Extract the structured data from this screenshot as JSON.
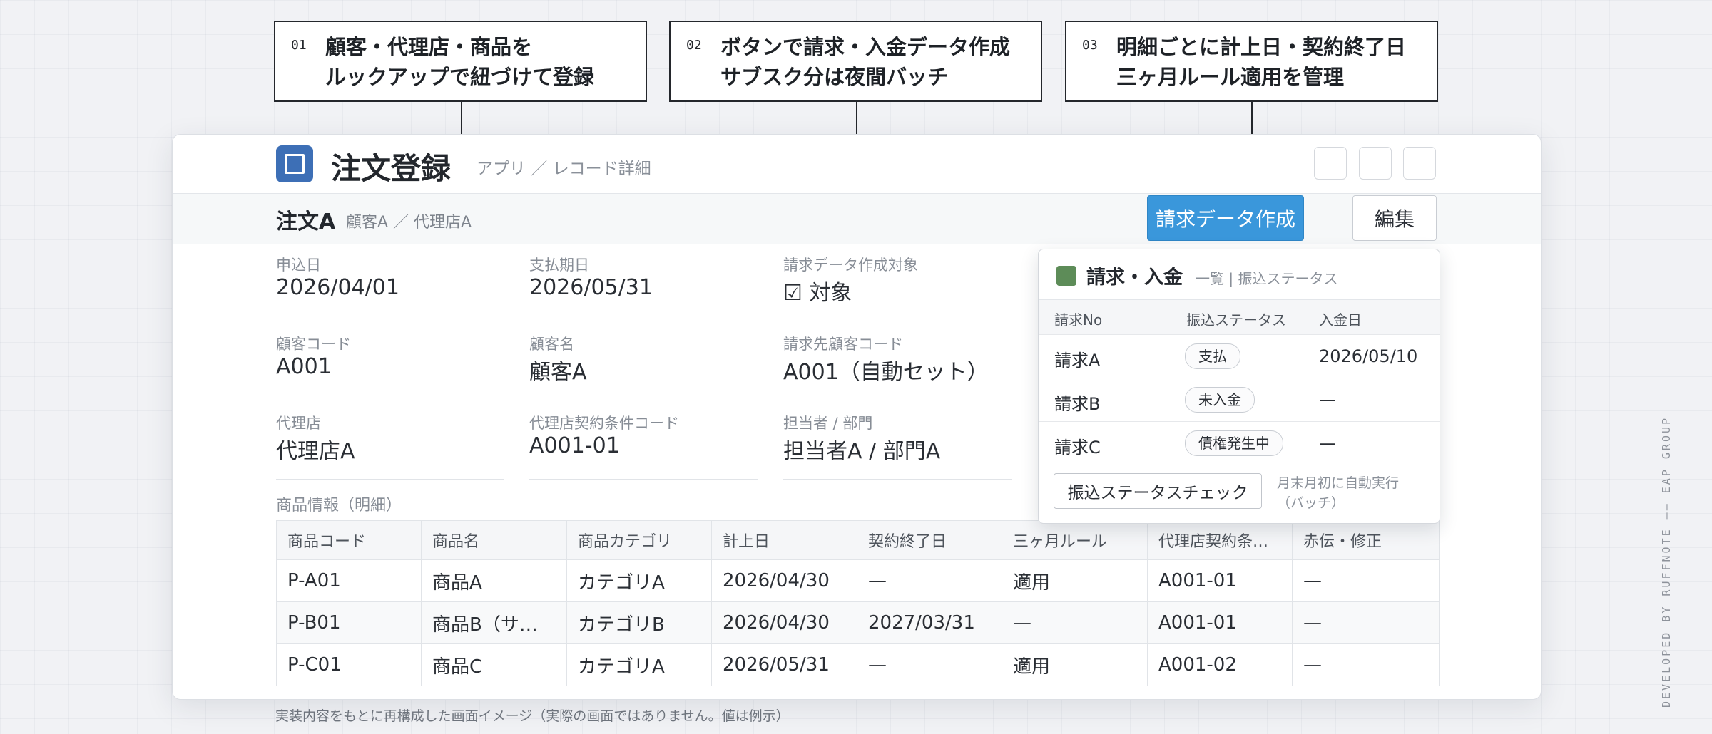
{
  "callouts": [
    {
      "num": "01",
      "line1": "顧客・代理店・商品を",
      "line2": "ルックアップで紐づけて登録"
    },
    {
      "num": "02",
      "line1": "ボタンで請求・入金データ作成",
      "line2": "サブスク分は夜間バッチ"
    },
    {
      "num": "03",
      "line1": "明細ごとに計上日・契約終了日",
      "line2": "三ヶ月ルール適用を管理"
    }
  ],
  "app": {
    "title": "注文登録",
    "breadcrumb": "アプリ ／ レコード詳細",
    "icon": "app-icon",
    "accent": "#3d6fb6"
  },
  "record": {
    "name": "注文A",
    "sub": "顧客A ／ 代理店A",
    "create_button": "請求データ作成",
    "edit_button": "編集",
    "primary_color": "#3a97db"
  },
  "fields": [
    {
      "label": "申込日",
      "value": "2026/04/01"
    },
    {
      "label": "支払期日",
      "value": "2026/05/31"
    },
    {
      "label": "請求データ作成対象",
      "value": "☑ 対象"
    },
    {
      "label": "顧客コード",
      "value": "A001"
    },
    {
      "label": "顧客名",
      "value": "顧客A"
    },
    {
      "label": "請求先顧客コード",
      "value": "A001（自動セット）"
    },
    {
      "label": "代理店",
      "value": "代理店A"
    },
    {
      "label": "代理店契約条件コード",
      "value": "A001-01"
    },
    {
      "label": "担当者 / 部門",
      "value": "担当者A / 部門A"
    }
  ],
  "detail": {
    "section_label": "商品情報（明細）",
    "columns": [
      "商品コード",
      "商品名",
      "商品カテゴリ",
      "計上日",
      "契約終了日",
      "三ヶ月ルール",
      "代理店契約条…",
      "赤伝・修正"
    ],
    "rows": [
      [
        "P-A01",
        "商品A",
        "カテゴリA",
        "2026/04/30",
        "—",
        "適用",
        "A001-01",
        "—"
      ],
      [
        "P-B01",
        "商品B（サブ…",
        "カテゴリB",
        "2026/04/30",
        "2027/03/31",
        "—",
        "A001-01",
        "—"
      ],
      [
        "P-C01",
        "商品C",
        "カテゴリA",
        "2026/05/31",
        "—",
        "適用",
        "A001-02",
        "—"
      ]
    ]
  },
  "panel": {
    "title": "請求・入金",
    "subtitle": "一覧 | 振込ステータス",
    "icon_color": "#5d8c58",
    "columns": [
      "請求No",
      "振込ステータス",
      "入金日"
    ],
    "rows": [
      {
        "no": "請求A",
        "status": "支払",
        "date": "2026/05/10"
      },
      {
        "no": "請求B",
        "status": "未入金",
        "date": "—"
      },
      {
        "no": "請求C",
        "status": "債権発生中",
        "date": "—"
      }
    ],
    "check_button": "振込ステータスチェック",
    "check_note_1": "月末月初に自動実行",
    "check_note_2": "（バッチ）"
  },
  "footnote": "実装内容をもとに再構成した画面イメージ（実際の画面ではありません。値は例示）",
  "credit": "DEVELOPED BY RUFFNOTE —— EAP GROUP"
}
